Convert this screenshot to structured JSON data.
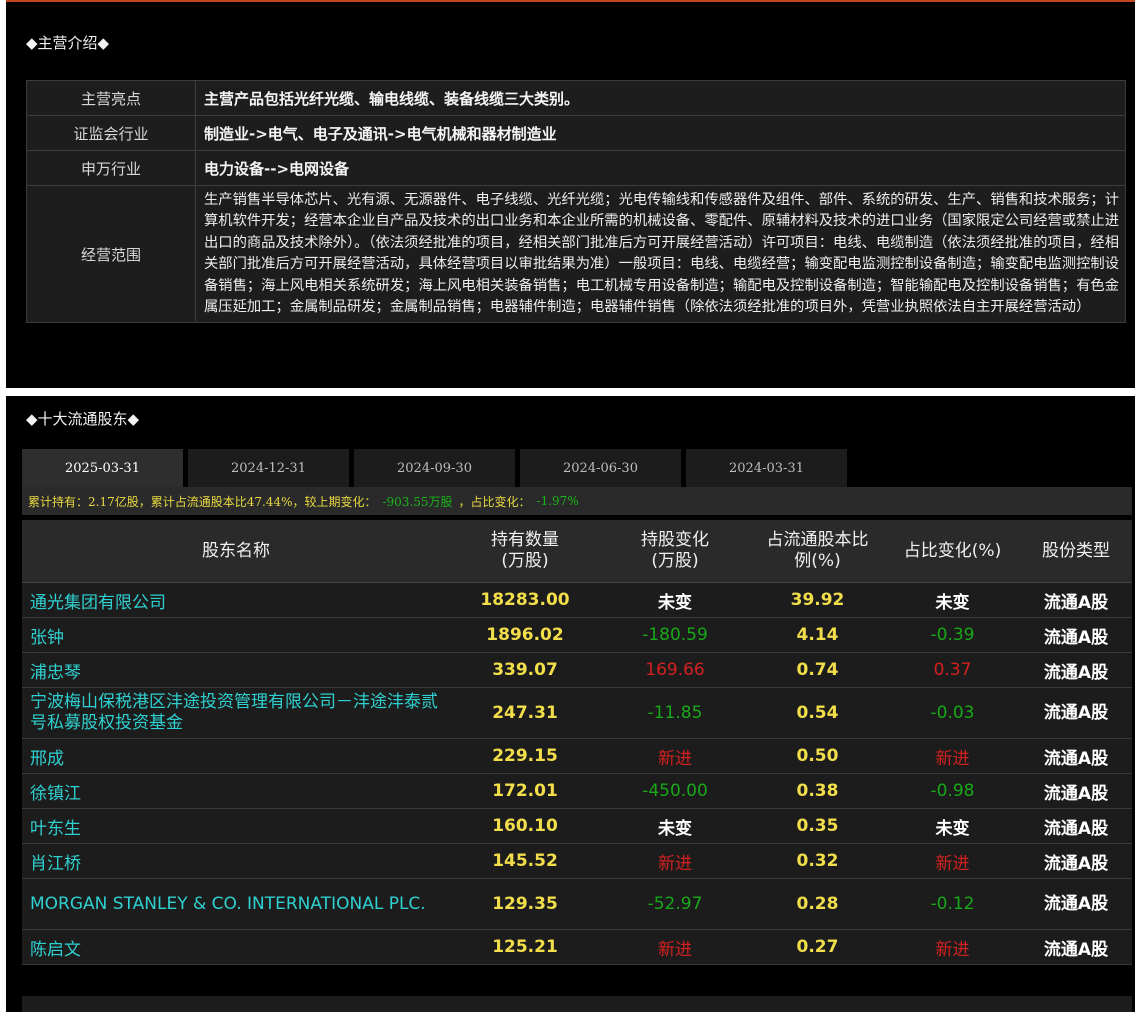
{
  "intro": {
    "title": "◆主营介绍◆",
    "rows": [
      {
        "label": "主营亮点",
        "value": "主营产品包括光纤光缆、输电线缆、装备线缆三大类别。"
      },
      {
        "label": "证监会行业",
        "value": "制造业->电气、电子及通讯->电气机械和器材制造业"
      },
      {
        "label": "申万行业",
        "value": "电力设备-->电网设备"
      }
    ],
    "scope_label": "经营范围",
    "scope_text": "生产销售半导体芯片、光有源、无源器件、电子线缆、光纤光缆；光电传输线和传感器件及组件、部件、系统的研发、生产、销售和技术服务；计算机软件开发；经营本企业自产品及技术的出口业务和本企业所需的机械设备、零配件、原辅材料及技术的进口业务（国家限定公司经营或禁止进出口的商品及技术除外）。（依法须经批准的项目，经相关部门批准后方可开展经营活动）许可项目：电线、电缆制造（依法须经批准的项目，经相关部门批准后方可开展经营活动，具体经营项目以审批结果为准）一般项目：电线、电缆经营；输变配电监测控制设备制造；输变配电监测控制设备销售；海上风电相关系统研发；海上风电相关装备销售；电工机械专用设备制造；输配电及控制设备制造；智能输配电及控制设备销售；有色金属压延加工；金属制品研发；金属制品销售；电器辅件制造；电器辅件销售（除依法须经批准的项目外，凭营业执照依法自主开展经营活动）"
  },
  "holders": {
    "title": "◆十大流通股东◆",
    "tabs": [
      "2025-03-31",
      "2024-12-31",
      "2024-09-30",
      "2024-06-30",
      "2024-03-31"
    ],
    "summary": {
      "prefix": "累计持有：2.17亿股，累计占流通股本比47.44%，较上期变化：",
      "change": "-903.55万股",
      "mid": "，占比变化：",
      "ratio_change": "-1.97%"
    },
    "columns": [
      "股东名称",
      "持有数量\n(万股)",
      "持股变化\n(万股)",
      "占流通股本比\n例(%)",
      "占比变化(%)",
      "股份类型"
    ],
    "rows": [
      {
        "name": "通光集团有限公司",
        "qty": "18283.00",
        "change": "未变",
        "pct": "39.92",
        "pct_change": "未变",
        "type": "流通A股"
      },
      {
        "name": "张钟",
        "qty": "1896.02",
        "change": "-180.59",
        "pct": "4.14",
        "pct_change": "-0.39",
        "type": "流通A股"
      },
      {
        "name": "浦忠琴",
        "qty": "339.07",
        "change": "169.66",
        "pct": "0.74",
        "pct_change": "0.37",
        "type": "流通A股"
      },
      {
        "name": "宁波梅山保税港区沣途投资管理有限公司－沣途沣泰贰号私募股权投资基金",
        "qty": "247.31",
        "change": "-11.85",
        "pct": "0.54",
        "pct_change": "-0.03",
        "type": "流通A股"
      },
      {
        "name": "邢成",
        "qty": "229.15",
        "change": "新进",
        "pct": "0.50",
        "pct_change": "新进",
        "type": "流通A股"
      },
      {
        "name": "徐镇江",
        "qty": "172.01",
        "change": "-450.00",
        "pct": "0.38",
        "pct_change": "-0.98",
        "type": "流通A股"
      },
      {
        "name": "叶东生",
        "qty": "160.10",
        "change": "未变",
        "pct": "0.35",
        "pct_change": "未变",
        "type": "流通A股"
      },
      {
        "name": "肖江桥",
        "qty": "145.52",
        "change": "新进",
        "pct": "0.32",
        "pct_change": "新进",
        "type": "流通A股"
      },
      {
        "name": "MORGAN STANLEY & CO. INTERNATIONAL PLC.",
        "qty": "129.35",
        "change": "-52.97",
        "pct": "0.28",
        "pct_change": "-0.12",
        "type": "流通A股"
      },
      {
        "name": "陈启文",
        "qty": "125.21",
        "change": "新进",
        "pct": "0.27",
        "pct_change": "新进",
        "type": "流通A股"
      }
    ]
  },
  "colors": {
    "name": "#2fd0d0",
    "value": "#f2de4a",
    "negative": "#18a818",
    "positive": "#d42020",
    "accent_line": "#c2461e"
  }
}
